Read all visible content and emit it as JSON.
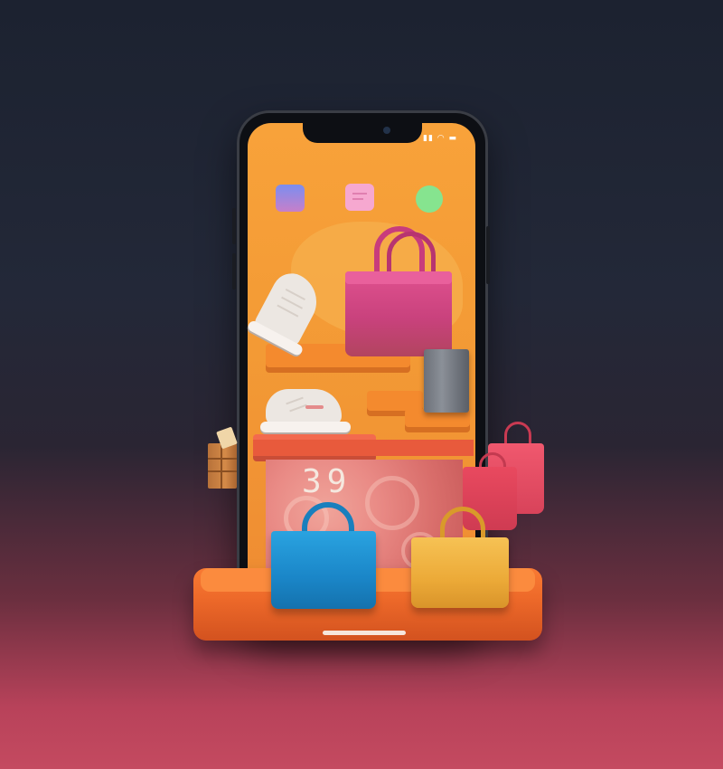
{
  "scene": {
    "description_free": true,
    "display_number": "39"
  },
  "status_bar": {
    "icons": [
      "signal-icon",
      "wifi-icon",
      "battery-icon"
    ],
    "glyphs": "▮▮ ◠ ▬"
  },
  "app_icons": [
    {
      "name": "purple-app-icon",
      "color": "#8a7ee0"
    },
    {
      "name": "pink-app-icon",
      "color": "#f5a6cf"
    },
    {
      "name": "green-app-icon",
      "color": "#7fe08c"
    }
  ],
  "colors": {
    "screen": "#f39a35",
    "platform": "#ee6a2a",
    "pink_bag": "#d94a8a",
    "blue_bag": "#1e8fcf",
    "yellow_bag": "#f2b43a",
    "red_bag": "#e8485f"
  }
}
